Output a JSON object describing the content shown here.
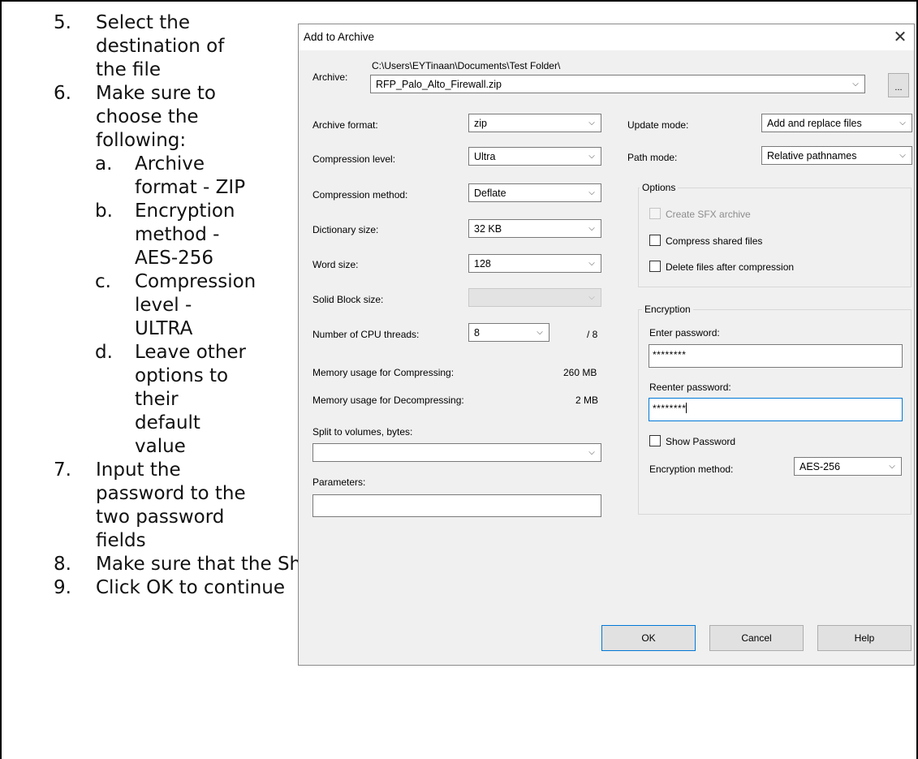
{
  "instructions": {
    "steps": [
      {
        "num": "5.",
        "lines": [
          "Select the",
          "destination of",
          "the file"
        ]
      },
      {
        "num": "6.",
        "lines": [
          "Make sure to",
          "choose the",
          "following:"
        ]
      },
      {
        "num": "a.",
        "lines": [
          "Archive",
          "format - ZIP"
        ]
      },
      {
        "num": "b.",
        "lines": [
          "Encryption",
          "method -",
          "AES-256"
        ]
      },
      {
        "num": "c.",
        "lines": [
          "Compression",
          "level -",
          "ULTRA"
        ]
      },
      {
        "num": "d.",
        "lines": [
          "Leave other",
          "options to",
          "their",
          "default",
          "value"
        ]
      },
      {
        "num": "7.",
        "lines": [
          "Input the",
          "password to the",
          "two password",
          "fields"
        ]
      },
      {
        "num": "8.",
        "lines": [
          "Make sure that the Show Password is uncheck"
        ]
      },
      {
        "num": "9.",
        "lines": [
          "Click OK to continue"
        ]
      }
    ]
  },
  "dialog": {
    "title": "Add to Archive",
    "close_icon": "close-icon",
    "archive": {
      "label": "Archive:",
      "path": "C:\\Users\\EYTinaan\\Documents\\Test Folder\\",
      "filename": "RFP_Palo_Alto_Firewall.zip",
      "browse_label": "..."
    },
    "left": {
      "archive_format": {
        "label": "Archive format:",
        "value": "zip"
      },
      "compression_level": {
        "label": "Compression level:",
        "value": "Ultra"
      },
      "compression_method": {
        "label": "Compression method:",
        "value": "Deflate"
      },
      "dictionary_size": {
        "label": "Dictionary size:",
        "value": "32 KB"
      },
      "word_size": {
        "label": "Word size:",
        "value": "128"
      },
      "solid_block_size": {
        "label": "Solid Block size:",
        "value": ""
      },
      "cpu_threads": {
        "label": "Number of CPU threads:",
        "value": "8",
        "total": "/ 8"
      },
      "memory_compress": {
        "label": "Memory usage for Compressing:",
        "value": "260 MB"
      },
      "memory_decompress": {
        "label": "Memory usage for Decompressing:",
        "value": "2 MB"
      },
      "split_volumes": {
        "label": "Split to volumes, bytes:",
        "value": ""
      },
      "parameters": {
        "label": "Parameters:",
        "value": ""
      }
    },
    "right": {
      "update_mode": {
        "label": "Update mode:",
        "value": "Add and replace files"
      },
      "path_mode": {
        "label": "Path mode:",
        "value": "Relative pathnames"
      },
      "options": {
        "title": "Options",
        "create_sfx": "Create SFX archive",
        "compress_shared": "Compress shared files",
        "delete_after": "Delete files after compression"
      },
      "encryption": {
        "title": "Encryption",
        "enter_password_label": "Enter password:",
        "enter_password_value": "********",
        "reenter_password_label": "Reenter password:",
        "reenter_password_value": "********",
        "show_password": "Show Password",
        "method_label": "Encryption method:",
        "method_value": "AES-256"
      }
    },
    "buttons": {
      "ok": "OK",
      "cancel": "Cancel",
      "help": "Help"
    },
    "chevron_icon": "chevron-down-icon"
  }
}
